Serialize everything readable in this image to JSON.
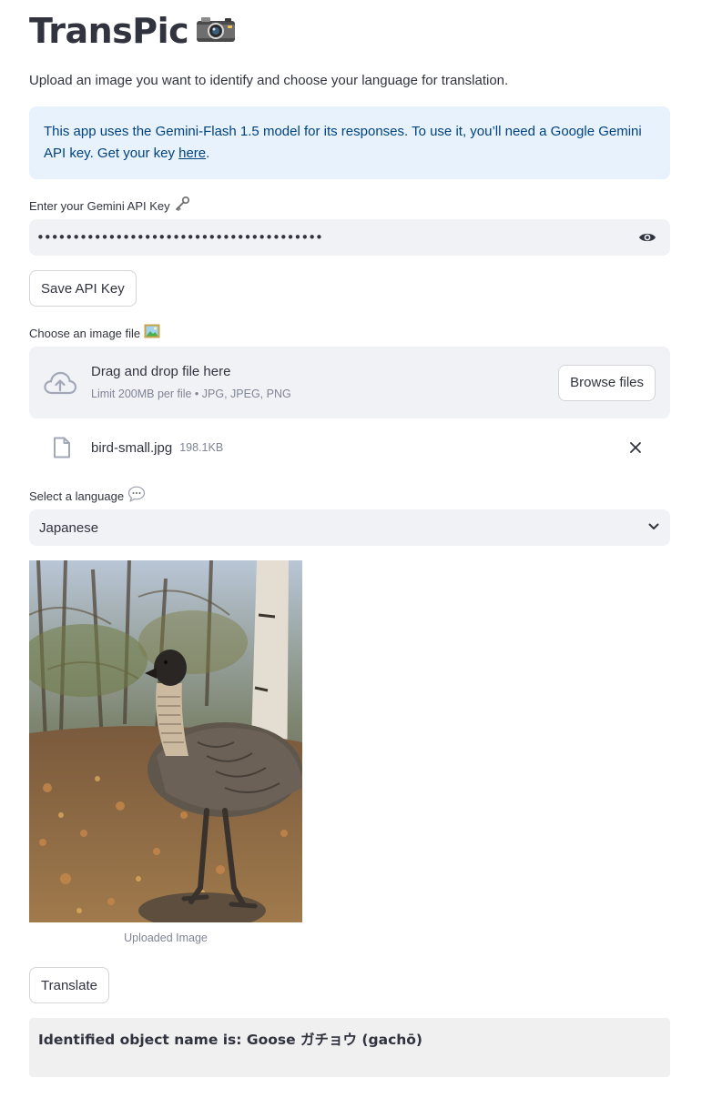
{
  "header": {
    "title": "TransPic",
    "title_icon": "camera-icon",
    "subtitle": "Upload an image you want to identify and choose your language for translation."
  },
  "info_box": {
    "text": "This app uses the Gemini-Flash 1.5 model for its responses. To use it, you’ll need a Google Gemini API key. Get your key ",
    "link_text": "here",
    "suffix": "."
  },
  "api_key": {
    "label": "Enter your Gemini API Key",
    "label_icon": "key-icon",
    "value": "••••••••••••••••••••••••••••••••••••••••",
    "visibility_icon": "eye-icon",
    "save_label": "Save API Key"
  },
  "upload": {
    "label": "Choose an image file",
    "label_icon": "framed-picture-icon",
    "drop_text": "Drag and drop file here",
    "limit_text": "Limit 200MB per file • JPG, JPEG, PNG",
    "browse_label": "Browse files",
    "file_name": "bird-small.jpg",
    "file_size": "198.1KB"
  },
  "language": {
    "label": "Select a language",
    "label_icon": "speech-bubble-icon",
    "selected": "Japanese"
  },
  "image": {
    "caption": "Uploaded Image"
  },
  "translate_label": "Translate",
  "result_text": "Identified object name is: Goose ガチョウ (gachō)",
  "colors": {
    "info_bg": "#e8f2fc",
    "info_text": "#004280",
    "input_bg": "#f0f2f6",
    "text": "#31333f",
    "muted": "#808495"
  }
}
